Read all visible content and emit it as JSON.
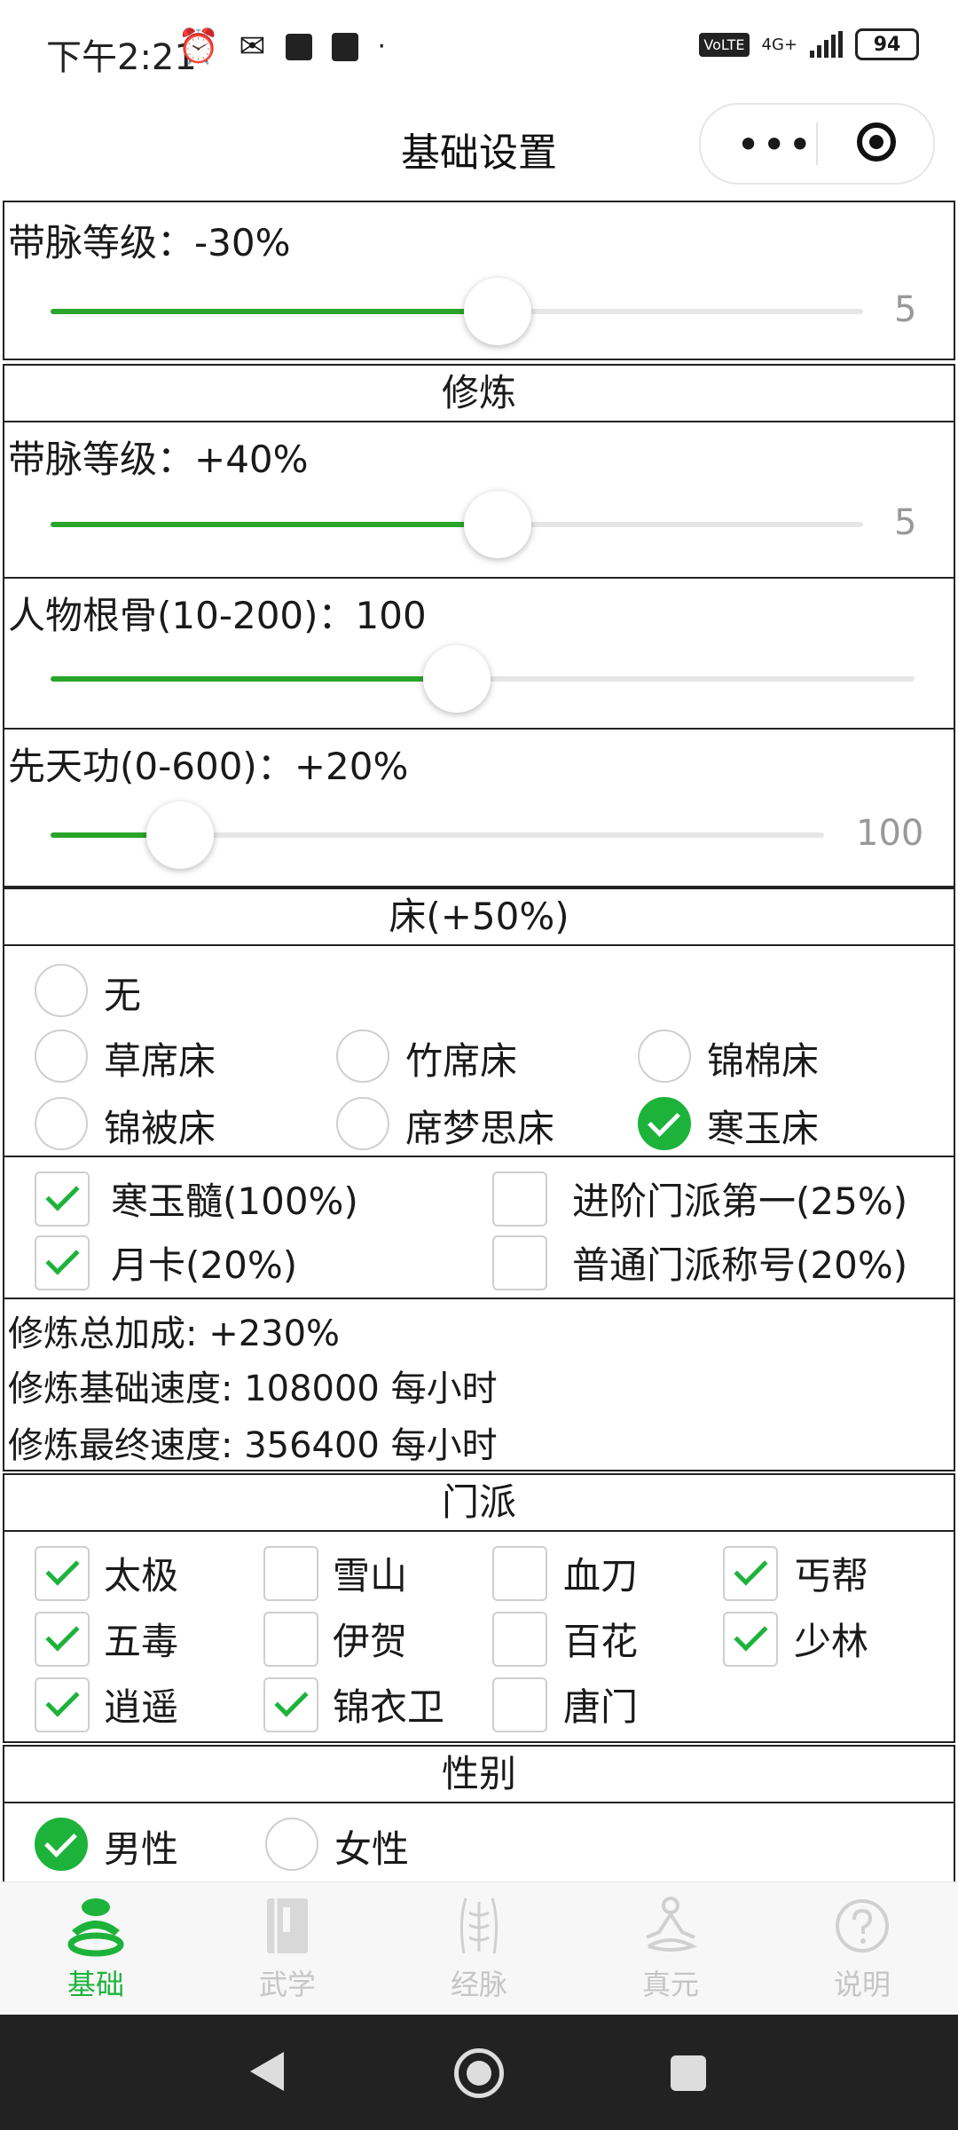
{
  "status": {
    "time": "下午2:21",
    "battery": "94",
    "network": "4G+"
  },
  "header": {
    "title": "基础设置"
  },
  "sections": {
    "top_slider": {
      "label": "带脉等级：-30%",
      "value_text": "5",
      "fraction": 0.55
    },
    "cultivation": {
      "title": "修炼",
      "slider1": {
        "label": "带脉等级：+40%",
        "value_text": "5",
        "fraction": 0.55
      },
      "slider2": {
        "label": "人物根骨(10-200)：100",
        "fraction": 0.47
      },
      "slider3": {
        "label": "先天功(0-600)：+20%",
        "value_text": "100",
        "fraction": 0.167
      }
    },
    "bed": {
      "title": "床(+50%)",
      "options": [
        "无",
        "草席床",
        "竹席床",
        "锦棉床",
        "锦被床",
        "席梦思床",
        "寒玉床"
      ],
      "selected": "寒玉床"
    },
    "bonuses": {
      "items": [
        {
          "label": "寒玉髓(100%)",
          "checked": true
        },
        {
          "label": "进阶门派第一(25%)",
          "checked": false
        },
        {
          "label": "月卡(20%)",
          "checked": true
        },
        {
          "label": "普通门派称号(20%)",
          "checked": false
        }
      ]
    },
    "summary": {
      "total": "修炼总加成: +230%",
      "base": "修炼基础速度: 108000 每小时",
      "final": "修炼最终速度: 356400 每小时"
    },
    "sect": {
      "title": "门派",
      "items": [
        {
          "label": "太极",
          "checked": true
        },
        {
          "label": "雪山",
          "checked": false
        },
        {
          "label": "血刀",
          "checked": false
        },
        {
          "label": "丐帮",
          "checked": true
        },
        {
          "label": "五毒",
          "checked": true
        },
        {
          "label": "伊贺",
          "checked": false
        },
        {
          "label": "百花",
          "checked": false
        },
        {
          "label": "少林",
          "checked": true
        },
        {
          "label": "逍遥",
          "checked": true
        },
        {
          "label": "锦衣卫",
          "checked": true
        },
        {
          "label": "唐门",
          "checked": false
        }
      ]
    },
    "gender": {
      "title": "性别",
      "options": [
        "男性",
        "女性"
      ],
      "selected": "男性"
    }
  },
  "tabs": [
    {
      "label": "基础",
      "icon": "hat-icon",
      "active": true
    },
    {
      "label": "武学",
      "icon": "book-icon",
      "active": false
    },
    {
      "label": "经脉",
      "icon": "meridian-icon",
      "active": false
    },
    {
      "label": "真元",
      "icon": "meditation-icon",
      "active": false
    },
    {
      "label": "说明",
      "icon": "help-icon",
      "active": false
    }
  ],
  "colors": {
    "accent": "#1db33b",
    "slider_fill": "#2aa52a"
  }
}
